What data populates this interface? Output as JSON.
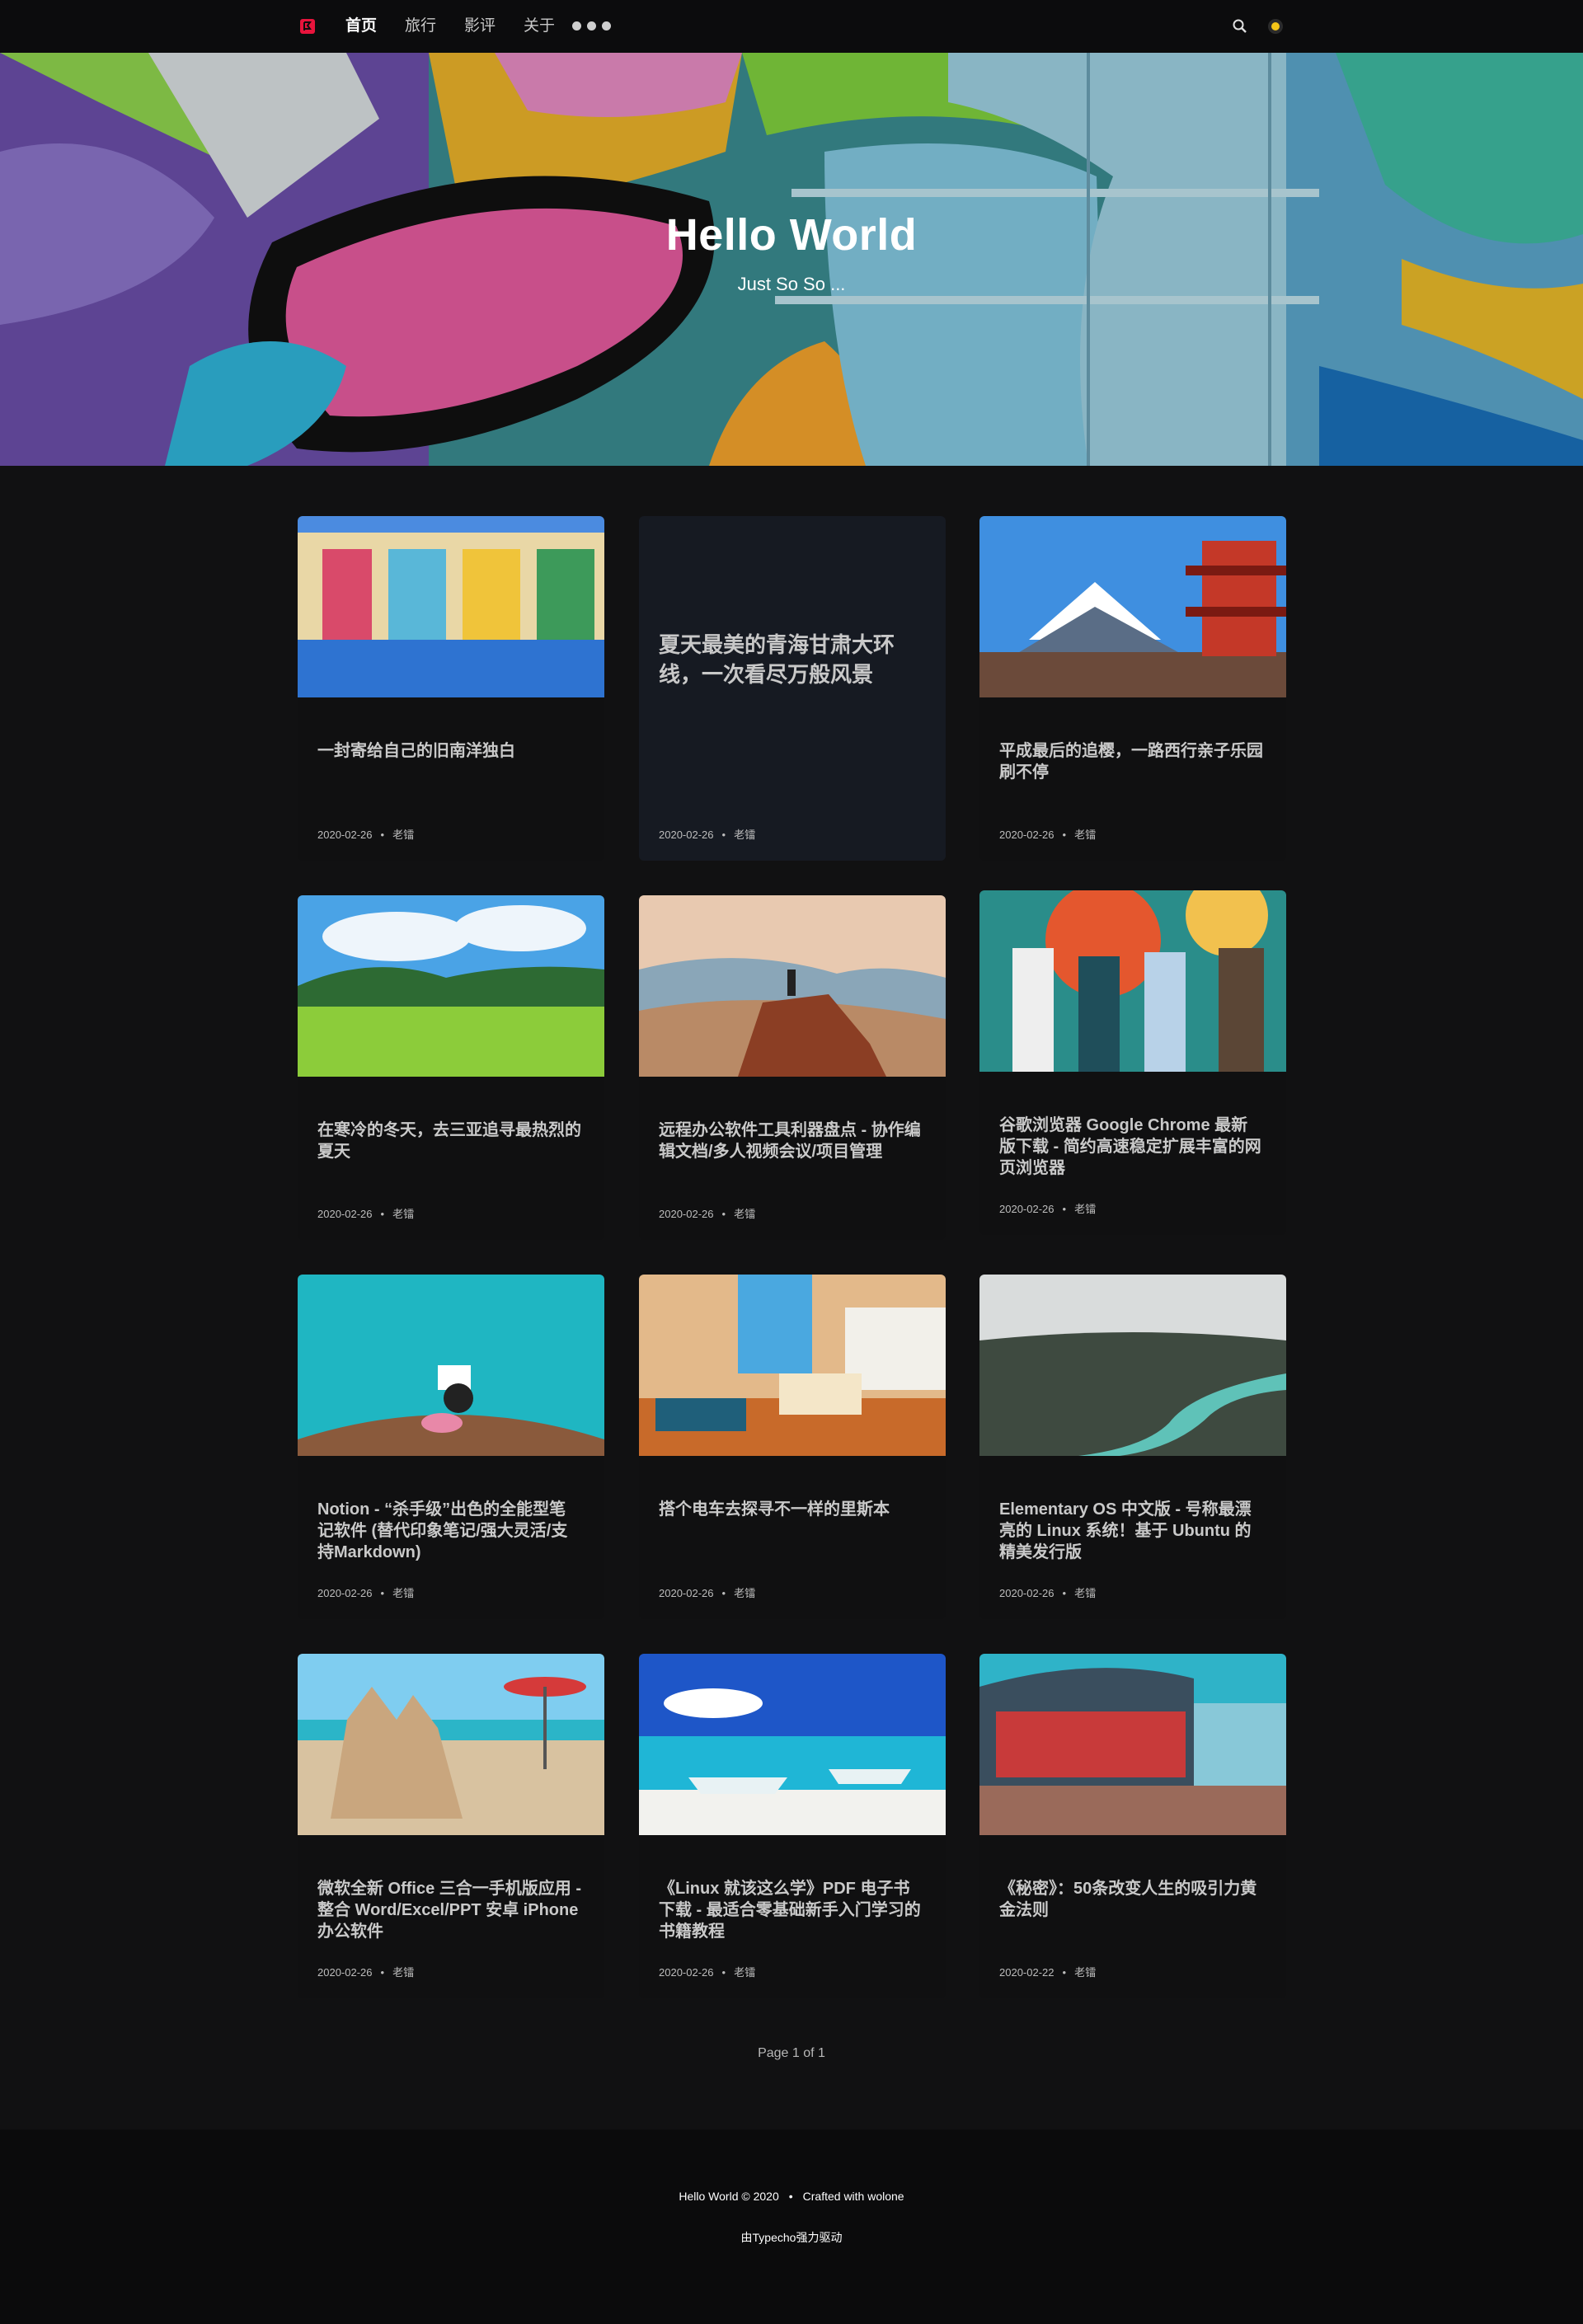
{
  "nav": {
    "logo_icon": "red-bookmark-logo-icon",
    "items": [
      {
        "label": "首页",
        "active": true
      },
      {
        "label": "旅行",
        "active": false
      },
      {
        "label": "影评",
        "active": false
      },
      {
        "label": "关于",
        "active": false
      }
    ],
    "more_icon": "more-dots-icon",
    "search_icon": "search-icon",
    "theme_icon": "theme-toggle-icon"
  },
  "hero": {
    "title": "Hello World",
    "subtitle": "Just So So ..."
  },
  "posts": [
    {
      "title": "一封寄给自己的旧南洋独白",
      "date": "2020-02-26",
      "author": "老镭",
      "image": "colorful-shophouse"
    },
    {
      "title": "夏天最美的青海甘肃大环线，一次看尽万般风景",
      "date": "2020-02-26",
      "author": "老镭",
      "image": ""
    },
    {
      "title": "平成最后的追樱，一路西行亲子乐园刷不停",
      "date": "2020-02-26",
      "author": "老镭",
      "image": "mount-fuji-pagoda"
    },
    {
      "title": "在寒冷的冬天，去三亚追寻最热烈的夏天",
      "date": "2020-02-26",
      "author": "老镭",
      "image": "green-rice-field"
    },
    {
      "title": "远程办公软件工具利器盘点 - 协作编辑文档/多人视频会议/项目管理",
      "date": "2020-02-26",
      "author": "老镭",
      "image": "person-on-rock"
    },
    {
      "title": "谷歌浏览器 Google Chrome 最新版下载 - 简约高速稳定扩展丰富的网页浏览器",
      "date": "2020-02-26",
      "author": "老镭",
      "image": "friends-mural-wall"
    },
    {
      "title": "Notion - “杀手级”出色的全能型笔记软件 (替代印象笔记/强大灵活/支持Markdown)",
      "date": "2020-02-26",
      "author": "老镭",
      "image": "pool-reading"
    },
    {
      "title": "搭个电车去探寻不一样的里斯本",
      "date": "2020-02-26",
      "author": "老镭",
      "image": "cozy-room"
    },
    {
      "title": "Elementary OS 中文版 - 号称最漂亮的 Linux 系统！基于 Ubuntu 的精美发行版",
      "date": "2020-02-26",
      "author": "老镭",
      "image": "snowy-river-forest"
    },
    {
      "title": "微软全新 Office 三合一手机版应用 - 整合 Word/Excel/PPT 安卓 iPhone 办公软件",
      "date": "2020-02-26",
      "author": "老镭",
      "image": "sand-castle-beach"
    },
    {
      "title": "《Linux 就该这么学》PDF 电子书下载 - 最适合零基础新手入门学习的书籍教程",
      "date": "2020-02-26",
      "author": "老镭",
      "image": "boats-on-beach"
    },
    {
      "title": "《秘密》：50条改变人生的吸引力黄金法则",
      "date": "2020-02-22",
      "author": "老镭",
      "image": "retro-diner"
    }
  ],
  "pager": "Page 1 of 1",
  "footer": {
    "copyright": "Hello World © 2020",
    "crafted": "Crafted with wolone",
    "powered": "由Typecho强力驱动"
  },
  "colors": {
    "background": "#111112",
    "nav_bg": "#0c0c0d",
    "accent_red": "#e8143c",
    "theme_yellow": "#f5c518"
  }
}
